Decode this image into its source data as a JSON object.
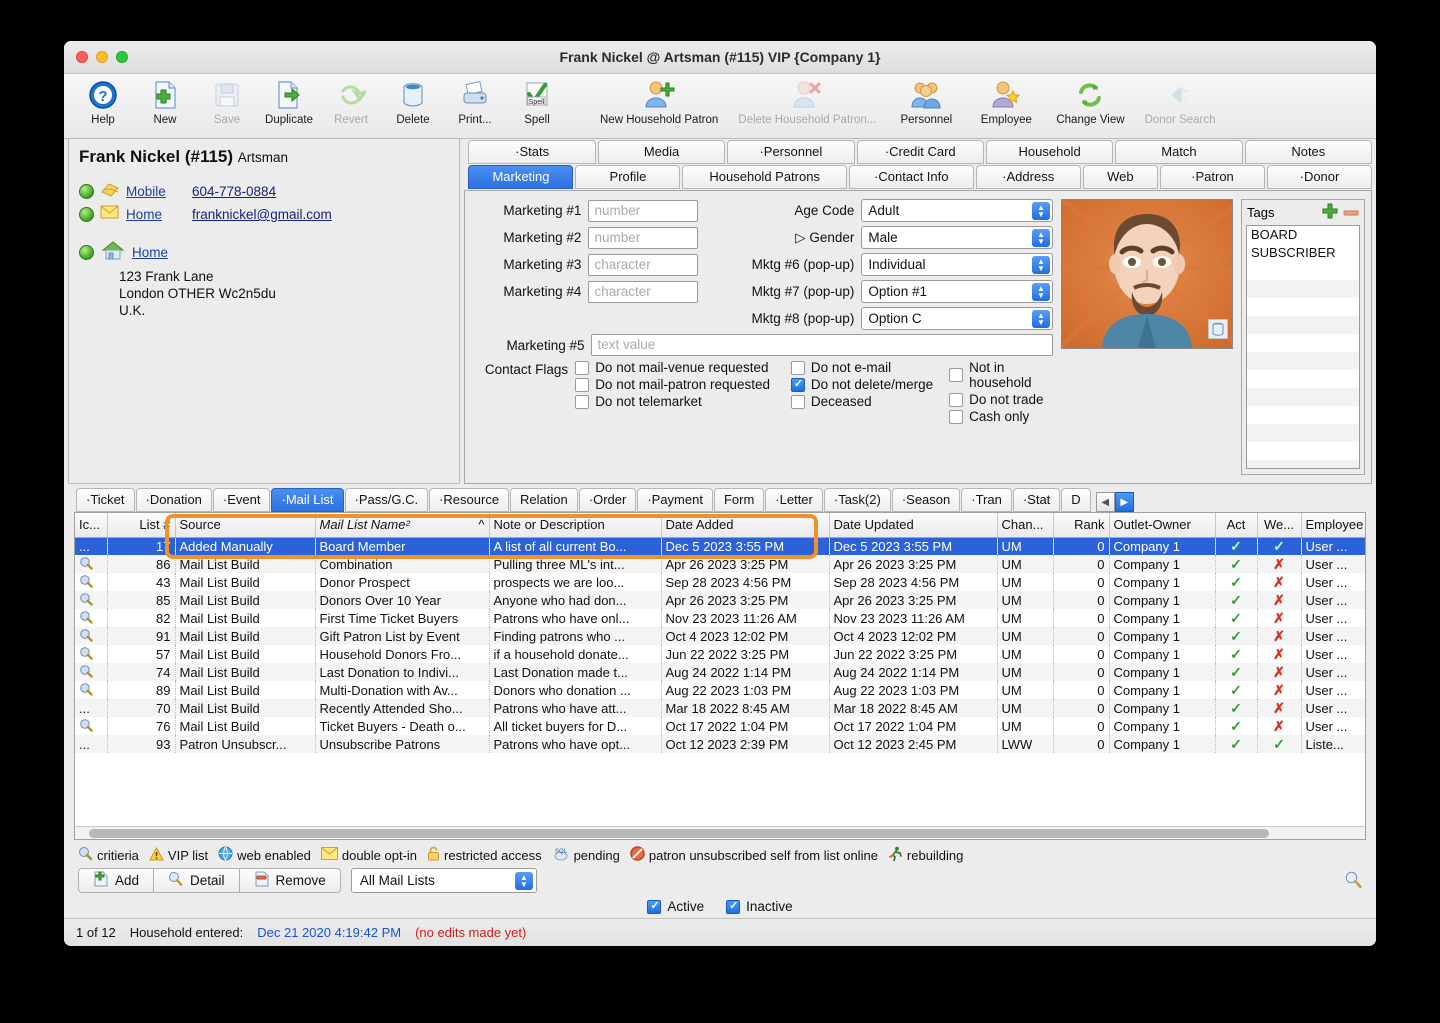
{
  "window": {
    "title": "Frank Nickel @ Artsman (#115) VIP {Company 1}"
  },
  "toolbar": [
    {
      "label": "Help",
      "icon": "help-icon",
      "disabled": false
    },
    {
      "label": "New",
      "icon": "new-document-icon",
      "disabled": false
    },
    {
      "label": "Save",
      "icon": "save-floppy-icon",
      "disabled": true
    },
    {
      "label": "Duplicate",
      "icon": "duplicate-icon",
      "disabled": false
    },
    {
      "label": "Revert",
      "icon": "revert-refresh-icon",
      "disabled": true
    },
    {
      "label": "Delete",
      "icon": "trash-can-icon",
      "disabled": false
    },
    {
      "label": "Print...",
      "icon": "printer-icon",
      "disabled": false
    },
    {
      "label": "Spell",
      "icon": "spell-check-icon",
      "disabled": false
    },
    {
      "label": "New Household Patron",
      "icon": "add-person-icon",
      "disabled": false
    },
    {
      "label": "Delete Household Patron...",
      "icon": "delete-person-icon",
      "disabled": true
    },
    {
      "label": "Personnel",
      "icon": "people-group-icon",
      "disabled": false
    },
    {
      "label": "Employee",
      "icon": "person-star-icon",
      "disabled": false
    },
    {
      "label": "Change View",
      "icon": "refresh-arrows-icon",
      "disabled": false
    },
    {
      "label": "Donor Search",
      "icon": "donor-search-icon",
      "disabled": true
    }
  ],
  "patron": {
    "name": "Frank Nickel (#115)",
    "org": "Artsman",
    "contacts": [
      {
        "type": "Mobile",
        "value": "604-778-0884",
        "icon": "phone-card-icon"
      },
      {
        "type": "Home",
        "value": "franknickel@gmail.com",
        "icon": "envelope-icon"
      }
    ],
    "address_label": "Home",
    "address_icon": "house-icon",
    "address_lines": [
      "123 Frank Lane",
      "London OTHER  Wc2n5du",
      "U.K."
    ]
  },
  "tabs_top": [
    {
      "label": "·Stats",
      "active": false
    },
    {
      "label": "Media",
      "active": false
    },
    {
      "label": "·Personnel",
      "active": false
    },
    {
      "label": "·Credit Card",
      "active": false
    },
    {
      "label": "Household",
      "active": false
    },
    {
      "label": "Match",
      "active": false
    },
    {
      "label": "Notes",
      "active": false
    }
  ],
  "tabs_second": [
    {
      "label": "Marketing",
      "active": true
    },
    {
      "label": "Profile",
      "active": false
    },
    {
      "label": "Household Patrons",
      "active": false
    },
    {
      "label": "·Contact Info",
      "active": false
    },
    {
      "label": "·Address",
      "active": false
    },
    {
      "label": "Web",
      "active": false
    },
    {
      "label": "·Patron",
      "active": false
    },
    {
      "label": "·Donor",
      "active": false
    }
  ],
  "marketing": {
    "fields_left": [
      {
        "label": "Marketing #1",
        "placeholder": "number",
        "value": ""
      },
      {
        "label": "Marketing #2",
        "placeholder": "number",
        "value": ""
      },
      {
        "label": "Marketing #3",
        "placeholder": "character",
        "value": ""
      },
      {
        "label": "Marketing #4",
        "placeholder": "character",
        "value": ""
      }
    ],
    "fields_right": [
      {
        "label": "Age Code",
        "value": "Adult"
      },
      {
        "label": "Gender",
        "value": "Male"
      },
      {
        "label": "Mktg #6 (pop-up)",
        "value": "Individual"
      },
      {
        "label": "Mktg #7 (pop-up)",
        "value": "Option #1"
      },
      {
        "label": "Mktg #8 (pop-up)",
        "value": "Option C"
      }
    ],
    "marketing5": {
      "label": "Marketing #5",
      "placeholder": "text value",
      "value": ""
    },
    "contact_flags_label": "Contact Flags",
    "flags": [
      {
        "label": "Do not mail-venue requested",
        "checked": false
      },
      {
        "label": "Do not mail-patron requested",
        "checked": false
      },
      {
        "label": "Do not telemarket",
        "checked": false
      },
      {
        "label": "Do not e-mail",
        "checked": false
      },
      {
        "label": "Do not delete/merge",
        "checked": true
      },
      {
        "label": "Deceased",
        "checked": false
      },
      {
        "label": "Not in household",
        "checked": false
      },
      {
        "label": "Do not trade",
        "checked": false
      },
      {
        "label": "Cash only",
        "checked": false
      }
    ]
  },
  "tags": {
    "title": "Tags",
    "add_icon": "plus-icon",
    "remove_icon": "minus-icon",
    "items": [
      "BOARD",
      "SUBSCRIBER"
    ]
  },
  "subtabs": [
    {
      "label": "·Ticket",
      "active": false
    },
    {
      "label": "·Donation",
      "active": false
    },
    {
      "label": "·Event",
      "active": false
    },
    {
      "label": "·Mail List",
      "active": true
    },
    {
      "label": "·Pass/G.C.",
      "active": false
    },
    {
      "label": "·Resource",
      "active": false
    },
    {
      "label": "Relation",
      "active": false
    },
    {
      "label": "·Order",
      "active": false
    },
    {
      "label": "·Payment",
      "active": false
    },
    {
      "label": "Form",
      "active": false
    },
    {
      "label": "·Letter",
      "active": false
    },
    {
      "label": "·Task(2)",
      "active": false
    },
    {
      "label": "·Season",
      "active": false
    },
    {
      "label": "·Tran",
      "active": false
    },
    {
      "label": "·Stat",
      "active": false
    },
    {
      "label": "D",
      "active": false
    }
  ],
  "table": {
    "columns": [
      "Ic...",
      "List #",
      "Source",
      "Mail List Name²",
      "Note or Description",
      "Date Added",
      "Date Updated",
      "Chan...",
      "Rank",
      "Outlet-Owner",
      "Act",
      "We...",
      "Employee"
    ],
    "sort_column": "Mail List Name²",
    "sort_indicator": "^",
    "rows": [
      {
        "icon": "ellipsis",
        "list": "17",
        "source": "Added Manually",
        "name": "Board Member",
        "note": "A list of all current Bo...",
        "added": "Dec 5 2023 3:55 PM",
        "updated": "Dec 5 2023 3:55 PM",
        "chan": "UM",
        "rank": "0",
        "owner": "Company 1",
        "act": "check",
        "web": "check",
        "employee": "User ...",
        "selected": true
      },
      {
        "icon": "criteria",
        "list": "86",
        "source": "Mail List Build",
        "name": "Combination",
        "note": "Pulling three ML's int...",
        "added": "Apr 26 2023 3:25 PM",
        "updated": "Apr 26 2023 3:25 PM",
        "chan": "UM",
        "rank": "0",
        "owner": "Company 1",
        "act": "check",
        "web": "x",
        "employee": "User ...",
        "selected": false
      },
      {
        "icon": "criteria",
        "list": "43",
        "source": "Mail List Build",
        "name": "Donor Prospect",
        "note": "prospects we are loo...",
        "added": "Sep 28 2023 4:56 PM",
        "updated": "Sep 28 2023 4:56 PM",
        "chan": "UM",
        "rank": "0",
        "owner": "Company 1",
        "act": "check",
        "web": "x",
        "employee": "User ...",
        "selected": false
      },
      {
        "icon": "criteria",
        "list": "85",
        "source": "Mail List Build",
        "name": "Donors Over 10 Year",
        "note": "Anyone who had don...",
        "added": "Apr 26 2023 3:25 PM",
        "updated": "Apr 26 2023 3:25 PM",
        "chan": "UM",
        "rank": "0",
        "owner": "Company 1",
        "act": "check",
        "web": "x",
        "employee": "User ...",
        "selected": false
      },
      {
        "icon": "criteria",
        "list": "82",
        "source": "Mail List Build",
        "name": "First Time Ticket Buyers",
        "note": "Patrons who have onl...",
        "added": "Nov 23 2023 11:26 AM",
        "updated": "Nov 23 2023 11:26 AM",
        "chan": "UM",
        "rank": "0",
        "owner": "Company 1",
        "act": "check",
        "web": "x",
        "employee": "User ...",
        "selected": false
      },
      {
        "icon": "criteria",
        "list": "91",
        "source": "Mail List Build",
        "name": "Gift Patron List by Event",
        "note": "Finding patrons who ...",
        "added": "Oct 4 2023 12:02 PM",
        "updated": "Oct 4 2023 12:02 PM",
        "chan": "UM",
        "rank": "0",
        "owner": "Company 1",
        "act": "check",
        "web": "x",
        "employee": "User ...",
        "selected": false
      },
      {
        "icon": "criteria",
        "list": "57",
        "source": "Mail List Build",
        "name": "Household Donors Fro...",
        "note": "if a household donate...",
        "added": "Jun 22 2022 3:25 PM",
        "updated": "Jun 22 2022 3:25 PM",
        "chan": "UM",
        "rank": "0",
        "owner": "Company 1",
        "act": "check",
        "web": "x",
        "employee": "User ...",
        "selected": false
      },
      {
        "icon": "criteria",
        "list": "74",
        "source": "Mail List Build",
        "name": "Last Donation to Indivi...",
        "note": "Last Donation made t...",
        "added": "Aug 24 2022 1:14 PM",
        "updated": "Aug 24 2022 1:14 PM",
        "chan": "UM",
        "rank": "0",
        "owner": "Company 1",
        "act": "check",
        "web": "x",
        "employee": "User ...",
        "selected": false
      },
      {
        "icon": "criteria",
        "list": "89",
        "source": "Mail List Build",
        "name": "Multi-Donation with Av...",
        "note": "Donors who donation ...",
        "added": "Aug 22 2023 1:03 PM",
        "updated": "Aug 22 2023 1:03 PM",
        "chan": "UM",
        "rank": "0",
        "owner": "Company 1",
        "act": "check",
        "web": "x",
        "employee": "User ...",
        "selected": false
      },
      {
        "icon": "ellipsis",
        "list": "70",
        "source": "Mail List Build",
        "name": "Recently Attended Sho...",
        "note": "Patrons who have att...",
        "added": "Mar 18 2022 8:45 AM",
        "updated": "Mar 18 2022 8:45 AM",
        "chan": "UM",
        "rank": "0",
        "owner": "Company 1",
        "act": "check",
        "web": "x",
        "employee": "User ...",
        "selected": false
      },
      {
        "icon": "criteria",
        "list": "76",
        "source": "Mail List Build",
        "name": "Ticket Buyers - Death o...",
        "note": "All ticket buyers for D...",
        "added": "Oct 17 2022 1:04 PM",
        "updated": "Oct 17 2022 1:04 PM",
        "chan": "UM",
        "rank": "0",
        "owner": "Company 1",
        "act": "check",
        "web": "x",
        "employee": "User ...",
        "selected": false
      },
      {
        "icon": "ellipsis",
        "list": "93",
        "source": "Patron Unsubscr...",
        "name": "Unsubscribe Patrons",
        "note": "Patrons who have opt...",
        "added": "Oct 12 2023 2:39 PM",
        "updated": "Oct 12 2023 2:45 PM",
        "chan": "LWW",
        "rank": "0",
        "owner": "Company 1",
        "act": "check",
        "web": "check",
        "employee": "Liste...",
        "selected": false
      }
    ]
  },
  "legend": [
    {
      "icon": "criteria-icon",
      "label": "critieria"
    },
    {
      "icon": "warning-icon",
      "label": "VIP list"
    },
    {
      "icon": "globe-icon",
      "label": "web enabled"
    },
    {
      "icon": "envelope-icon",
      "label": "double opt-in"
    },
    {
      "icon": "lock-icon",
      "label": "restricted access"
    },
    {
      "icon": "sql-icon",
      "label": "pending"
    },
    {
      "icon": "no-entry-icon",
      "label": "patron unsubscribed self from list online"
    },
    {
      "icon": "running-person-icon",
      "label": "rebuilding"
    }
  ],
  "buttons": {
    "add": "Add",
    "detail": "Detail",
    "remove": "Remove",
    "add_icon": "add-document-icon",
    "detail_icon": "magnifier-icon",
    "remove_icon": "remove-document-icon",
    "filter_value": "All Mail Lists",
    "magnifier_icon": "magnifier-icon"
  },
  "filters": [
    {
      "label": "Active",
      "checked": true
    },
    {
      "label": "Inactive",
      "checked": true
    }
  ],
  "statusbar": {
    "position": "1 of 12",
    "entered_label": "Household entered:",
    "entered_date": "Dec 21 2020 4:19:42 PM",
    "edit_state": "(no edits made yet)"
  },
  "colors": {
    "accent": "#2b62d9",
    "highlight": "#f0922b",
    "ok": "#2fa02f",
    "bad": "#d93025"
  }
}
